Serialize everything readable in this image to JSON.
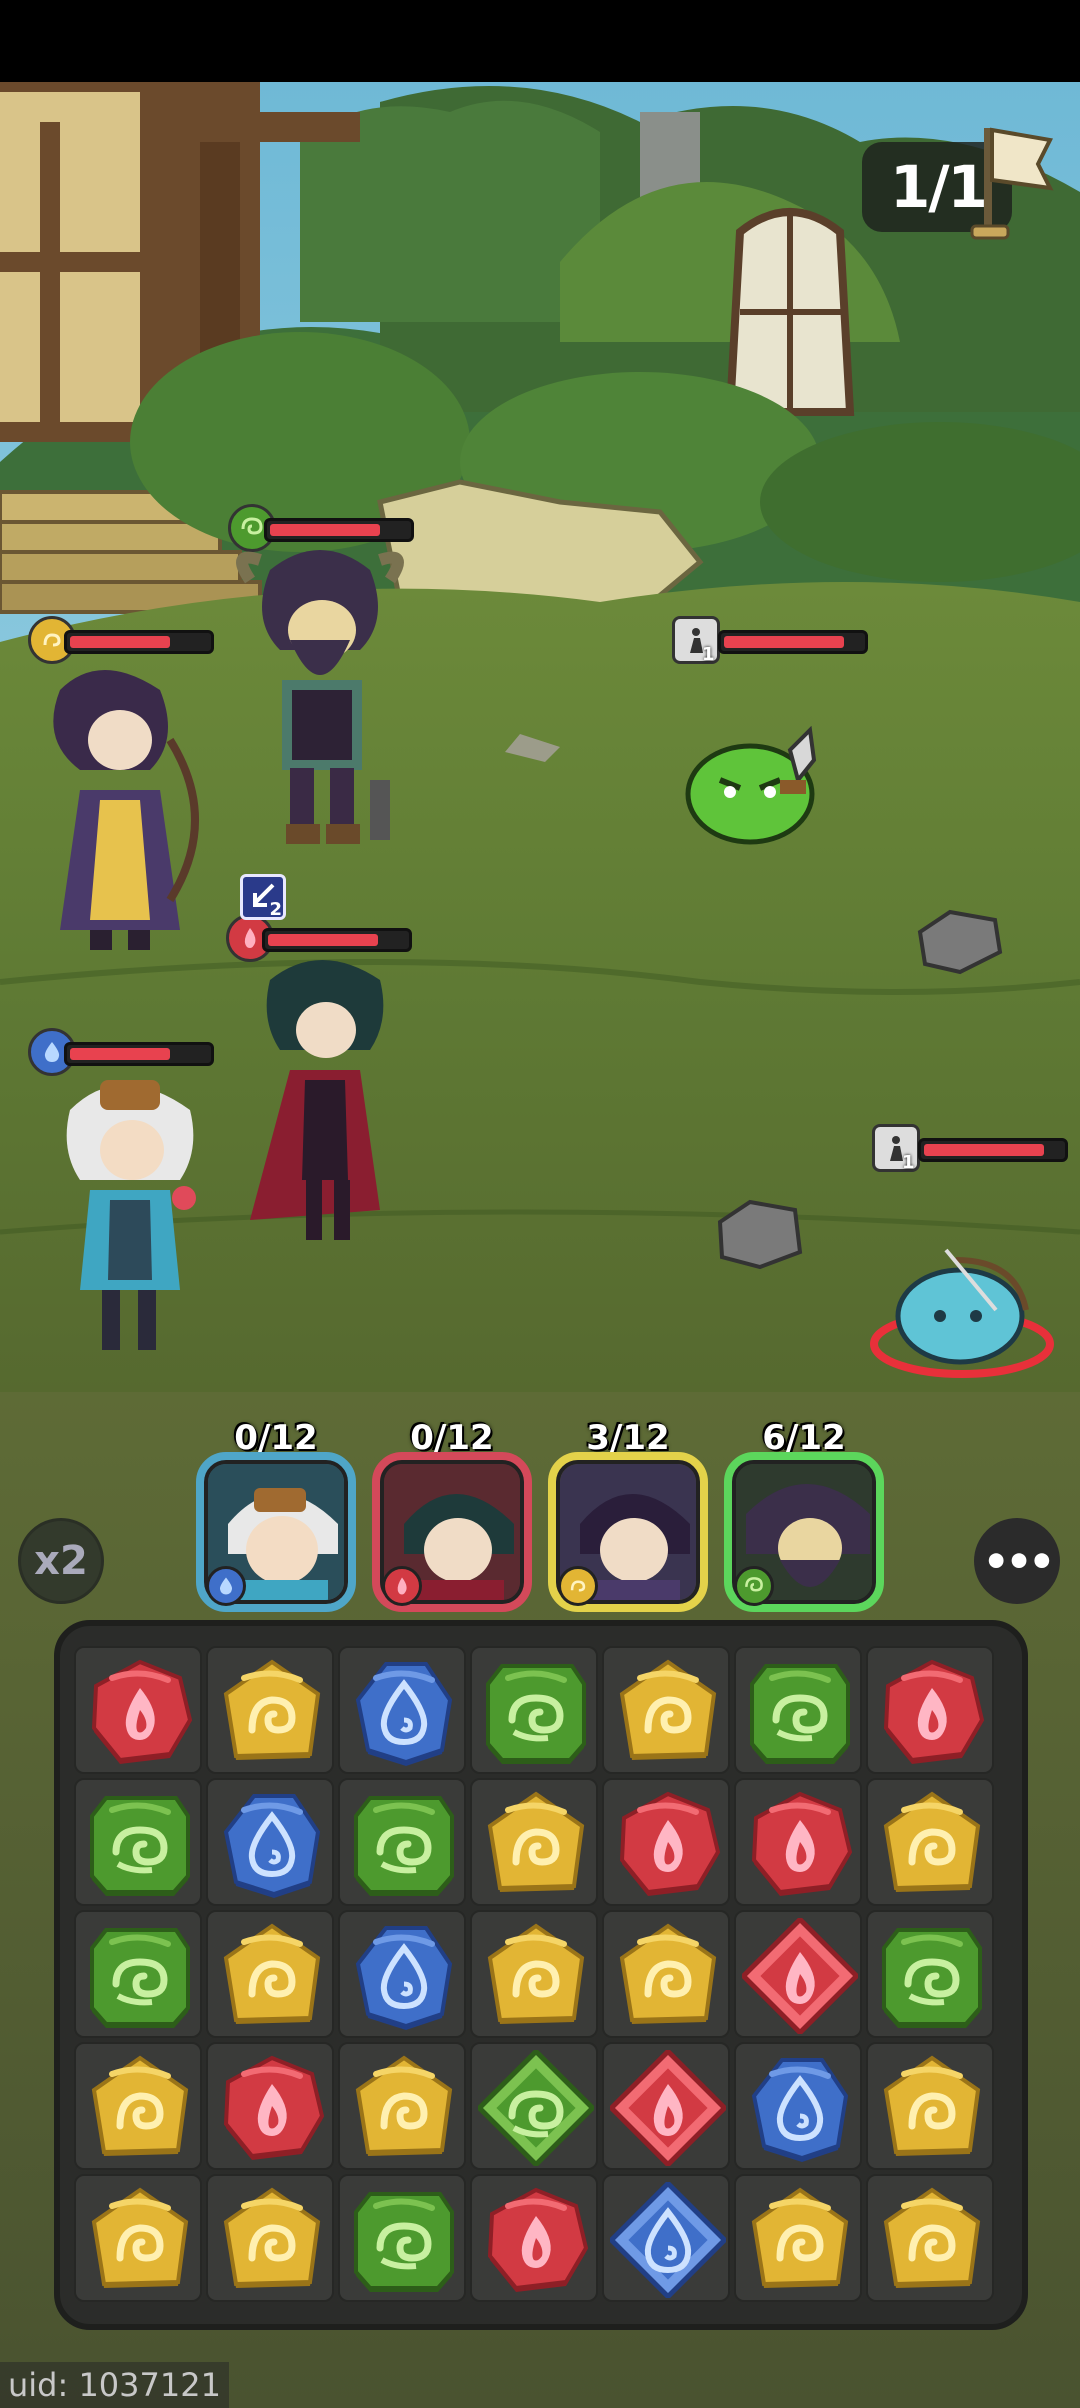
{
  "stage": {
    "label": "1/1"
  },
  "heroes": [
    {
      "name": "tinker",
      "element": "water",
      "charge": "0/12",
      "frame_color": "#4fa6c8"
    },
    {
      "name": "swordsman",
      "element": "fire",
      "charge": "0/12",
      "frame_color": "#d4495a"
    },
    {
      "name": "archer",
      "element": "earth",
      "charge": "3/12",
      "frame_color": "#e3d24a"
    },
    {
      "name": "warrior",
      "element": "wind",
      "charge": "6/12",
      "frame_color": "#5cd65c"
    }
  ],
  "buff_badge": {
    "value": "2"
  },
  "enemy_badges": [
    "1",
    "1"
  ],
  "speed": {
    "label": "x2"
  },
  "menu": {
    "label": "•••"
  },
  "uid": {
    "label": "uid: 1037121"
  },
  "colors": {
    "hp": "#e8424f",
    "fire": "#d23a43",
    "earth": "#e2b534",
    "water": "#3f6fc9",
    "wind": "#4d9a2e"
  },
  "board": [
    [
      "fire",
      "earth",
      "water",
      "wind",
      "earth",
      "wind",
      "fire"
    ],
    [
      "wind",
      "water",
      "wind",
      "earth",
      "fire",
      "fire",
      "earth"
    ],
    [
      "wind",
      "earth",
      "water",
      "earth",
      "earth",
      "fire-special",
      "wind"
    ],
    [
      "earth",
      "fire",
      "earth",
      "wind-special",
      "fire-special",
      "water",
      "earth"
    ],
    [
      "earth",
      "earth",
      "wind",
      "fire",
      "water-special",
      "earth",
      "earth"
    ]
  ]
}
